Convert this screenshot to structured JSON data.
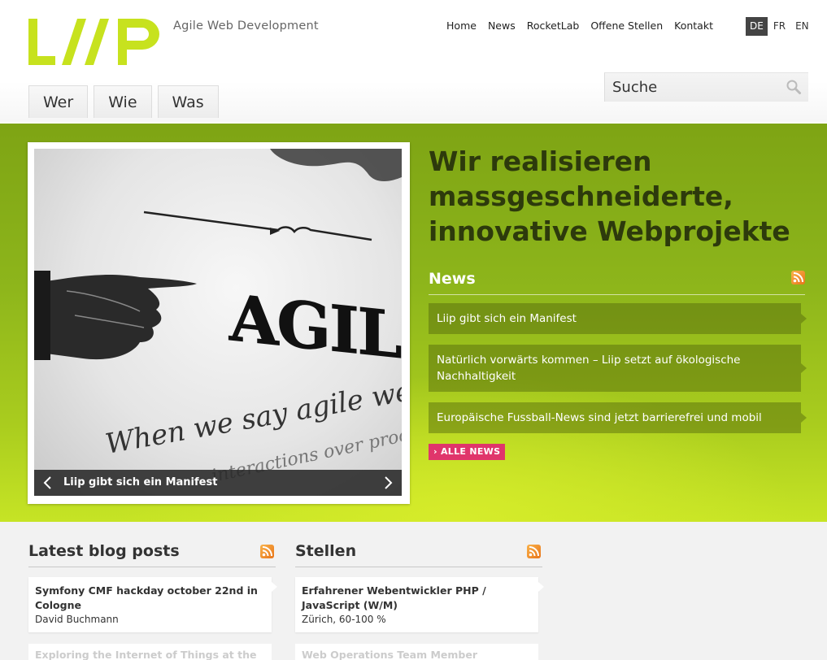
{
  "header": {
    "logo_text": "LIIP",
    "tagline": "Agile Web Development",
    "nav": [
      "Home",
      "News",
      "RocketLab",
      "Offene Stellen",
      "Kontakt"
    ],
    "languages": [
      {
        "code": "DE",
        "active": true
      },
      {
        "code": "FR",
        "active": false
      },
      {
        "code": "EN",
        "active": false
      }
    ],
    "tabs": [
      "Wer",
      "Wie",
      "Was"
    ],
    "search": {
      "placeholder": "Suche",
      "icon": "magnifier-icon"
    }
  },
  "hero": {
    "slider": {
      "caption": "Liip gibt sich ein Manifest",
      "image_description": "Pointing hand and AGILE type — 'When we say agile we value' ... 'interactions over processes'"
    },
    "heading": "Wir realisieren massgeschneiderte, innovative Webprojekte",
    "news": {
      "title": "News",
      "items": [
        "Liip gibt sich ein Manifest",
        "Natürlich vorwärts kommen – Liip setzt auf ökologische Nachhaltigkeit",
        "Europäische Fussball-News sind jetzt barrierefrei und mobil"
      ],
      "all_label": "ALLE NEWS"
    }
  },
  "blog": {
    "title": "Latest blog posts",
    "posts": [
      {
        "title": "Symfony CMF hackday october 22nd in Cologne",
        "author": "David Buchmann"
      },
      {
        "title": "Exploring the Internet of Things at the"
      }
    ]
  },
  "jobs": {
    "title": "Stellen",
    "items": [
      {
        "title": "Erfahrener Webentwickler PHP / JavaScript (W/M)",
        "detail": "Zürich, 60-100 %"
      },
      {
        "title": "Web Operations Team Member"
      }
    ]
  },
  "colors": {
    "logo_lime": "#c7e21e",
    "hero_green_dark": "#7ea414",
    "hero_green_light": "#c6e425",
    "alle_news_pink": "#e0356b",
    "rss_orange": "#f29b35"
  }
}
